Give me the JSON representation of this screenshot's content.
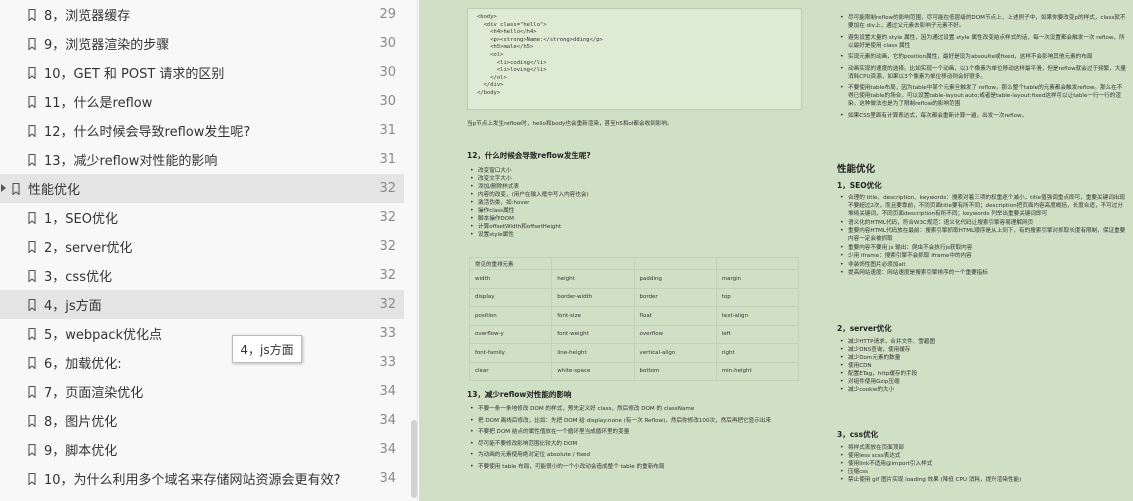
{
  "toc": {
    "items": [
      {
        "title": "8，浏览器缓存",
        "page": "29",
        "level": 2
      },
      {
        "title": "9，浏览器渲染的步骤",
        "page": "30",
        "level": 2
      },
      {
        "title": "10，GET 和 POST 请求的区别",
        "page": "30",
        "level": 2
      },
      {
        "title": "11，什么是reflow",
        "page": "30",
        "level": 2
      },
      {
        "title": "12，什么时候会导致reflow发生呢?",
        "page": "31",
        "level": 2
      },
      {
        "title": "13，减少reflow对性能的影响",
        "page": "31",
        "level": 2
      },
      {
        "title": "性能优化",
        "page": "32",
        "level": 1
      },
      {
        "title": "1，SEO优化",
        "page": "32",
        "level": 2
      },
      {
        "title": "2，server优化",
        "page": "32",
        "level": 2
      },
      {
        "title": "3，css优化",
        "page": "32",
        "level": 2
      },
      {
        "title": "4，js方面",
        "page": "32",
        "level": 2
      },
      {
        "title": "5，webpack优化点",
        "page": "33",
        "level": 2
      },
      {
        "title": "6，加载优化:",
        "page": "33",
        "level": 2
      },
      {
        "title": "7，页面渲染优化",
        "page": "34",
        "level": 2
      },
      {
        "title": "8，图片优化",
        "page": "34",
        "level": 2
      },
      {
        "title": "9，脚本优化",
        "page": "34",
        "level": 2
      },
      {
        "title": "10，为什么利用多个域名来存储网站资源会更有效?",
        "page": "34",
        "level": 2
      }
    ]
  },
  "tooltip": "4，js方面",
  "doc": {
    "code_lines": [
      "<body>",
      "  <div class=\"hello\">",
      "    <h4>hello</h4>",
      "    <p><strong>Name:</strong>dding</p>",
      "    <h5>male</h5>",
      "    <ol>",
      "      <li>coding</li>",
      "      <li>loving</li>",
      "    </ol>",
      "  </div>",
      "</body>"
    ],
    "after_code": "当p节点上发生reflow时，hello和body也会重新渲染，甚至h5和ol都会收到影响。",
    "h12": "12，什么时候会导致reflow发生呢?",
    "h12_bullets": [
      "改变窗口大小",
      "改变文字大小",
      "添加/删除样式表",
      "内容的改变，(用户在输入框中写入内容也会)",
      "激活伪类，如:hover",
      "操作class属性",
      "脚本操作DOM",
      "计算offsetWidth和offsetHeight",
      "设置style属性"
    ],
    "table_header": "常见的重排元素",
    "table_rows": [
      [
        "width",
        "height",
        "padding",
        "margin"
      ],
      [
        "display",
        "border-width",
        "border",
        "top"
      ],
      [
        "position",
        "font-size",
        "float",
        "text-align"
      ],
      [
        "overflow-y",
        "font-weight",
        "overflow",
        "left"
      ],
      [
        "font-family",
        "line-height",
        "vertical-align",
        "right"
      ],
      [
        "clear",
        "white-space",
        "bottom",
        "min-height"
      ]
    ],
    "h13": "13，减少reflow对性能的影响",
    "h13_bullets": [
      "不要一条一条地修改 DOM 的样式，预先定义好 class，然后修改 DOM 的 className",
      "把 DOM 离线后修改，比如：先把 DOM 给 display:none (有一次 Reflow)，然后你修改100次，然后再把它显示出来",
      "不要把 DOM 结点的属性值放在一个循环里当成循环里的变量",
      "尽可能不要修改影响范围比较大的 DOM",
      "为动画的元素使用绝对定位 absolute / fixed",
      "不要使用 table 布局，可能很小的一个小改动会造成整个 table 的重新布局"
    ],
    "col2_top_bullets": [
      "尽可能限制reflow的影响范围，尽可能在低层级的DOM节点上，上述例子中，如果你要改变p的样式，class就不要加在 div上，通过父元素去影响子元素不好。",
      "避免设置大量的 style 属性，因为通过设置 style 属性改变结点样式的话，每一次设置都会触发一次 reflow，所以最好是使用 class 属性",
      "实现元素的动画，它的position属性，最好是设为absoulte或fixed，这样不会影响其他元素的布局",
      "动画实现的速度的选择。比如实现一个动画，以1个像素为单位移动这样最平滑，但是reflow就会过于频繁，大量消耗CPU资源，如果以3个像素为单位移动则会好很多。",
      "不要使用table布局，因为table中某个元素旦触发了 reflow，那么整个table的元素都会触发reflow。那么在不得已使用table的场合，可以设置table-layout:auto;或者是table-layout:fixed这样可以让table一行一行的渲染，这种做法也是为了限制reflow的影响范围",
      "如果CSS里面有计算表达式，每次都会重新计算一遍，出发一次reflow。"
    ],
    "perf_title": "性能优化",
    "seo_title": "1，SEO优化",
    "seo_bullets": [
      "合理的 title、description、keywords：搜索对着三项的权重逐个减小，title值强调重点即可，重要关键词出现不要超过2次，而且要靠前，不同页面title要有所不同；description把页面内容高度概括，长度合适，不可过分堆砌关键词，不同页面description有所不同；keywords 列举出重要关键词即可",
      "语义化的HTML代码，符合W3C规范：语义化代码让搜索引擎容易理解网页",
      "重要内容HTML代码放在最前：搜索引擎抓取HTML顺序是从上到下，有的搜索引擎对抓取长度有限制，保证重要内容一定会被抓取",
      "重要内容不要用 js 输出：爬虫不会执行js获取内容",
      "少用 iframe：搜索引擎不会抓取 iframe中的内容",
      "非装饰性图片必须加alt",
      "提高网站速度：网站速度是搜索引擎排序的一个重要指标"
    ],
    "server_title": "2，server优化",
    "server_bullets": [
      "减少HTTP请求，合并文件、雪碧图",
      "减少DNS查询，使用缓存",
      "减少Dom元素的数量",
      "使用CDN",
      "配置ETag，http缓存的手段",
      "对组件使用Gzip压缩",
      "减少cookie的大小"
    ],
    "css_title": "3，css优化",
    "css_bullets": [
      "将样式表放在页面顶部",
      "使用less scss表达式",
      "使用link不适用@import引入样式",
      "压缩css",
      "禁止使用 gif 图片实现 loading 效果 (降低 CPU 消耗，提升渲染性能)"
    ]
  }
}
